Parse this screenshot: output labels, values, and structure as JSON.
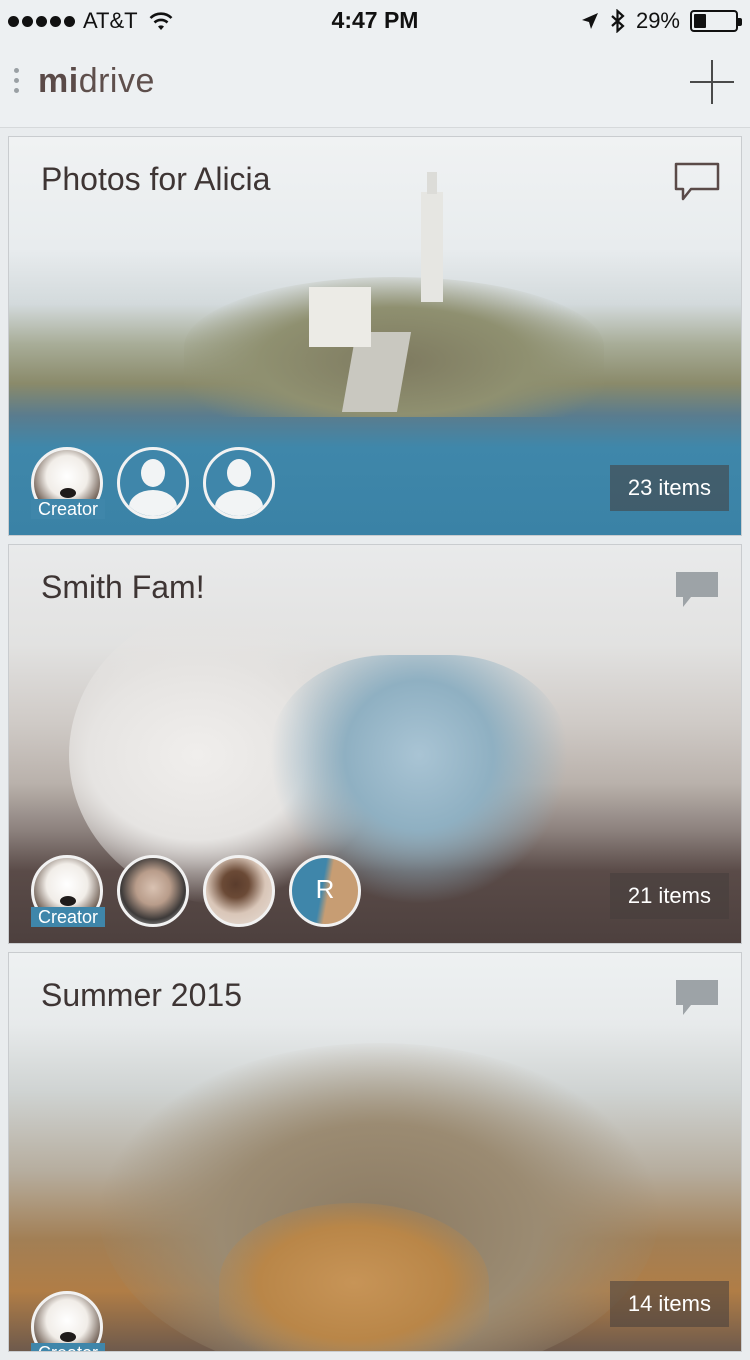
{
  "status_bar": {
    "carrier": "AT&T",
    "time": "4:47 PM",
    "battery": "29%",
    "battery_level": 0.29,
    "signal_bars": 5
  },
  "header": {
    "logo_bold": "mi",
    "logo_light": "drive"
  },
  "albums": [
    {
      "title": "Photos for Alicia",
      "items": "23 items",
      "creator_label": "Creator"
    },
    {
      "title": "Smith Fam!",
      "items": "21 items",
      "creator_label": "Creator",
      "initial_avatar": "R"
    },
    {
      "title": "Summer 2015",
      "items": "14 items",
      "creator_label": "Creator"
    }
  ],
  "colors": {
    "accent": "#3f86aa",
    "title_text": "#3e3534",
    "background": "#e9ecee"
  }
}
